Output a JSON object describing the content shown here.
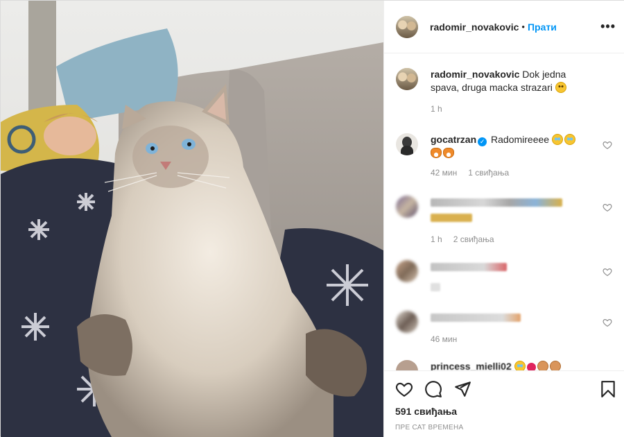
{
  "post": {
    "author": "radomir_novakovic",
    "follow_label": "Прати",
    "separator": "•",
    "more_label": "•••",
    "caption": "Dok jedna spava, druga macka strazari",
    "caption_time": "1 h"
  },
  "comments": [
    {
      "user": "gocatrzan",
      "verified": true,
      "text": "Radomireeee",
      "emojis": [
        "crying-laughing-face",
        "crying-laughing-face",
        "cat-face",
        "cat-face"
      ],
      "time": "42 мин",
      "likes": "1 свиђања"
    },
    {
      "user": "",
      "blurred": true,
      "time": "1 h",
      "likes": "2 свиђања"
    },
    {
      "user": "",
      "blurred": true,
      "time": "",
      "likes": ""
    },
    {
      "user": "",
      "blurred": true,
      "time": "46 мин",
      "likes": ""
    },
    {
      "user": "princess_mielli02",
      "partial": true
    }
  ],
  "footer": {
    "likes": "591 свиђања",
    "time": "ПРЕ САТ ВРЕМЕНА"
  },
  "icons": {
    "like": "heart-icon",
    "comment": "comment-bubble-icon",
    "share": "paper-plane-icon",
    "save": "bookmark-icon"
  },
  "colors": {
    "accent": "#0095f6",
    "text": "#262626",
    "muted": "#8e8e8e",
    "border": "#efefef"
  }
}
